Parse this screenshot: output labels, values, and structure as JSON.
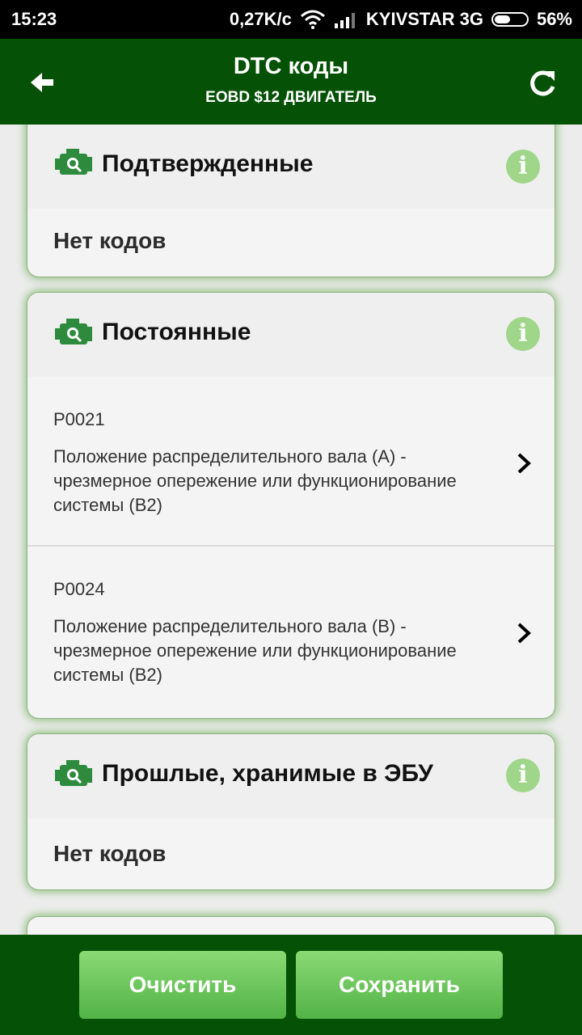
{
  "status_bar": {
    "time": "15:23",
    "speed": "0,27K/c",
    "carrier": "KYIVSTAR 3G",
    "battery": "56%",
    "battery_level": 0.56
  },
  "app_bar": {
    "title": "DTC коды",
    "subtitle": "EOBD $12 ДВИГАТЕЛЬ",
    "back_icon": "arrow-left-icon",
    "refresh_icon": "refresh-icon"
  },
  "sections": [
    {
      "title": "Подтвержденные",
      "empty_text": "Нет кодов"
    },
    {
      "title": "Постоянные",
      "items": [
        {
          "code": "P0021",
          "description": "Положение распределительного вала (А) - чрезмерное опережение или функционирование системы (В2)"
        },
        {
          "code": "P0024",
          "description": "Положение распределительного вала (В) - чрезмерное опережение или функционирование системы (В2)"
        }
      ]
    },
    {
      "title": "Прошлые, хранимые в ЭБУ",
      "empty_text": "Нет кодов"
    }
  ],
  "buttons": {
    "clear": "Очистить",
    "save": "Сохранить"
  },
  "colors": {
    "app_bar": "#055105",
    "accent_light": "#8ada74",
    "info_icon": "#9fd68a",
    "engine_icon": "#2e8b3e"
  }
}
